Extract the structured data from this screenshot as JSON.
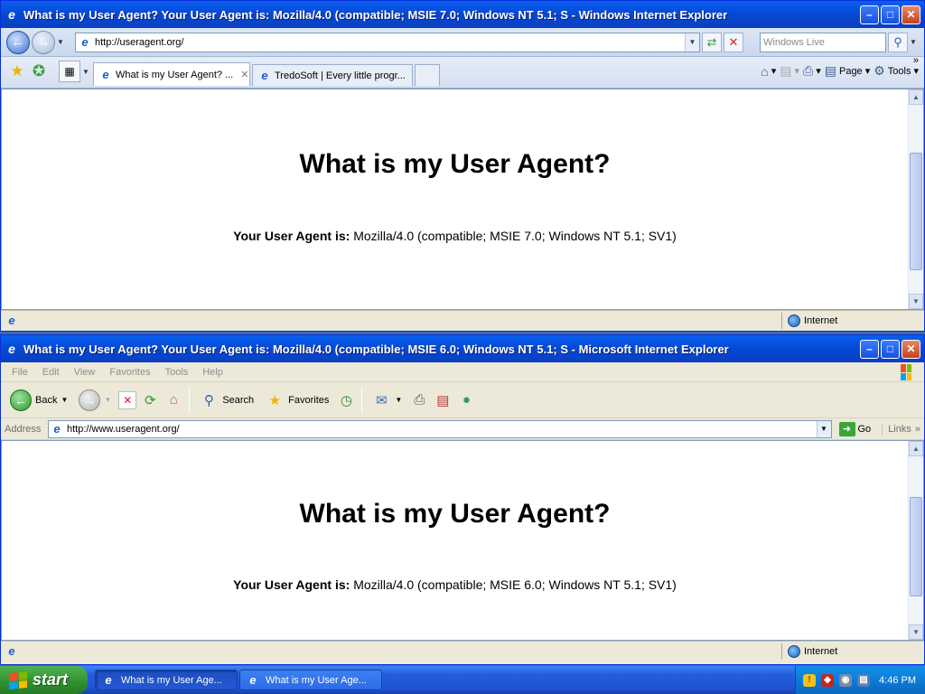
{
  "ie7": {
    "title": "What is my User Agent? Your User Agent is: Mozilla/4.0 (compatible; MSIE 7.0; Windows NT 5.1; S - Windows Internet Explorer",
    "url": "http://useragent.org/",
    "search_placeholder": "Windows Live",
    "tabs": [
      {
        "label": "What is my User Agent? ..."
      },
      {
        "label": "TredoSoft | Every little progr..."
      }
    ],
    "commands": {
      "page": "Page",
      "tools": "Tools"
    },
    "page": {
      "heading": "What is my User Agent?",
      "ua_label": "Your User Agent is:",
      "ua_value": "Mozilla/4.0 (compatible; MSIE 7.0; Windows NT 5.1; SV1)"
    },
    "status_zone": "Internet"
  },
  "ie6": {
    "title": "What is my User Agent? Your User Agent is: Mozilla/4.0 (compatible; MSIE 6.0; Windows NT 5.1; S - Microsoft Internet Explorer",
    "menu": [
      "File",
      "Edit",
      "View",
      "Favorites",
      "Tools",
      "Help"
    ],
    "toolbar": {
      "back": "Back",
      "search": "Search",
      "favorites": "Favorites"
    },
    "address_label": "Address",
    "url": "http://www.useragent.org/",
    "go": "Go",
    "links": "Links",
    "page": {
      "heading": "What is my User Agent?",
      "ua_label": "Your User Agent is:",
      "ua_value": "Mozilla/4.0 (compatible; MSIE 6.0; Windows NT 5.1; SV1)"
    },
    "status_zone": "Internet"
  },
  "taskbar": {
    "start": "start",
    "buttons": [
      {
        "label": "What is my User Age..."
      },
      {
        "label": "What is my User Age..."
      }
    ],
    "clock": "4:46 PM"
  },
  "colors": {
    "xp_blue": "#0a5fef",
    "start_green": "#2f8f2f",
    "tray_blue": "#0e7bd8"
  }
}
